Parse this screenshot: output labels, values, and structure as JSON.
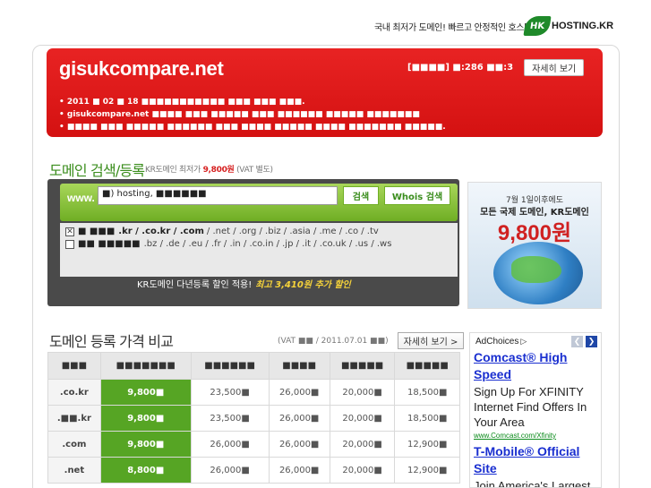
{
  "top_banner": {
    "tagline": "국내 최저가 도메인! 빠르고 안정적인 호스팅!",
    "logo_mark": "HK",
    "logo_text": "HOSTING.KR"
  },
  "header": {
    "site_title": "gisukcompare.net",
    "stats": "[■■■■] ■:286 ■■:3",
    "detail_button": "자세히 보기",
    "info_lines": [
      "• 2011 ■ 02 ■ 18 ■■■■■■■■■■■ ■■■ ■■■ ■■■.",
      "• gisukcompare.net ■■■■ ■■■ ■■■■■ ■■■ ■■■■■■ ■■■■■ ■■■■■■■",
      "• ■■■■ ■■■ ■■■■■ ■■■■■■ ■■■ ■■■■ ■■■■■ ■■■■ ■■■■■■■ ■■■■■."
    ]
  },
  "search": {
    "title": "도메인 검색/등록",
    "subtitle_prefix": "KR도메인 최저가",
    "subtitle_price": "9,800원",
    "subtitle_suffix": "(VAT 별도)",
    "www_label": "www.",
    "input_value": "■) hosting, ■■■■■■",
    "search_button": "검색",
    "whois_button": "Whois 검색",
    "row1_label": "■ ■■■",
    "row1_tlds_strong": ".kr / .co.kr / .com",
    "row1_tlds": "/ .net / .org / .biz / .asia / .me / .co / .tv",
    "row2_label": "■■ ■■■■■",
    "row2_tlds": ".bz / .de / .eu / .fr / .in / .co.in / .jp / .it / .co.uk / .us / .ws",
    "promo_text": "KR도메인 다년등록 할인 적용!",
    "promo_highlight": "최고 3,410원 추가 할인"
  },
  "right_banner": {
    "line1": "7월 1일이후에도",
    "line2": "모든 국제 도메인, KR도메인",
    "price": "9,800원"
  },
  "price_compare": {
    "title": "도메인 등록 가격 비교",
    "meta": "(VAT ■■ / 2011.07.01 ■■)",
    "detail_button": "자세히 보기 >",
    "headers": [
      "■■■",
      "■■■■■■■",
      "■■■■■■",
      "■■■■",
      "■■■■■",
      "■■■■■"
    ],
    "rows": [
      {
        "tld": ".co.kr",
        "cells": [
          "9,800■",
          "23,500■",
          "26,000■",
          "20,000■",
          "18,500■"
        ]
      },
      {
        "tld": ".■■.kr",
        "cells": [
          "9,800■",
          "23,500■",
          "26,000■",
          "20,000■",
          "18,500■"
        ]
      },
      {
        "tld": ".com",
        "cells": [
          "9,800■",
          "26,000■",
          "26,000■",
          "20,000■",
          "12,900■"
        ]
      },
      {
        "tld": ".net",
        "cells": [
          "8,800■",
          "26,000■",
          "26,000■",
          "20,000■",
          "12,900■"
        ]
      }
    ]
  },
  "ads": {
    "label": "AdChoices",
    "items": [
      {
        "title": "Comcast® High Speed",
        "body": "Sign Up For XFINITY Internet Find Offers In Your Area",
        "url": "www.Comcast.com/Xfinity"
      },
      {
        "title": "T-Mobile® Official Site",
        "body": "Join America's Largest"
      }
    ]
  },
  "colors": {
    "header_red": "#d41111",
    "brand_green": "#56a524",
    "link_blue": "#1a2fd0"
  }
}
